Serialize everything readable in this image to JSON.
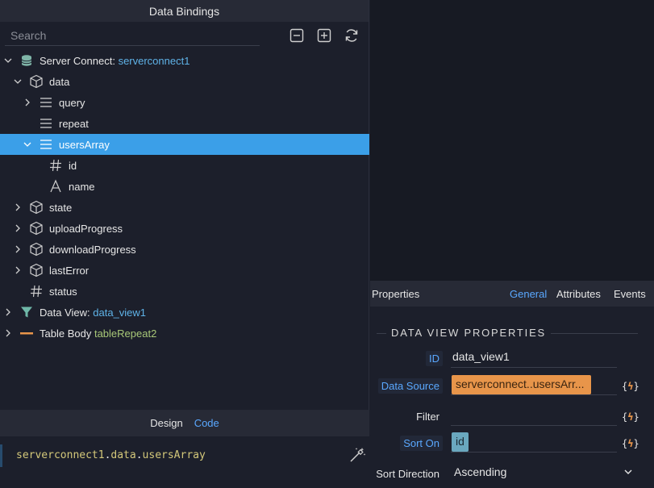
{
  "left_panel": {
    "title": "Data Bindings",
    "search_placeholder": "Search",
    "tree": [
      {
        "label": "Server Connect:",
        "suffix": "serverconnect1"
      },
      {
        "label": "data"
      },
      {
        "label": "query"
      },
      {
        "label": "repeat"
      },
      {
        "label": "usersArray"
      },
      {
        "label": "id"
      },
      {
        "label": "name"
      },
      {
        "label": "state"
      },
      {
        "label": "uploadProgress"
      },
      {
        "label": "downloadProgress"
      },
      {
        "label": "lastError"
      },
      {
        "label": "status"
      },
      {
        "label": "Data View:",
        "suffix": "data_view1"
      },
      {
        "label": "Table Body",
        "suffix": "tableRepeat2"
      }
    ]
  },
  "bottom_tabs": {
    "design": "Design",
    "code": "Code"
  },
  "code": {
    "part1": "serverconnect1",
    "sep1": ".",
    "part2": "data",
    "sep2": ".",
    "part3": "usersArray"
  },
  "properties": {
    "title": "Properties",
    "tabs": {
      "general": "General",
      "attributes": "Attributes",
      "events": "Events"
    },
    "section": "DATA VIEW PROPERTIES",
    "fields": {
      "id_label": "ID",
      "id_value": "data_view1",
      "datasource_label": "Data Source",
      "datasource_value": "serverconnect..usersArr...",
      "filter_label": "Filter",
      "sorton_label": "Sort On",
      "sorton_value": "id",
      "sortdir_label": "Sort Direction",
      "sortdir_value": "Ascending"
    },
    "bind_button_open": "{",
    "bind_button_close": "}"
  },
  "colors": {
    "selected_row": "#3b9fe8",
    "accent_blue": "#5aa8ff",
    "orange_chip": "#e8954a",
    "teal_chip": "#6aa8bf"
  }
}
